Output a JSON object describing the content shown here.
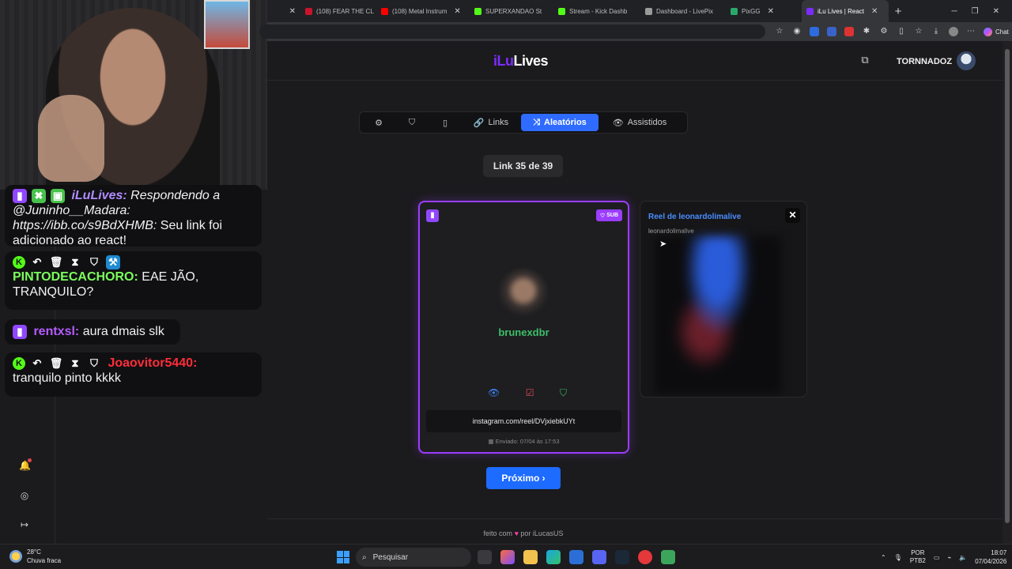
{
  "browser": {
    "tabs": [
      {
        "title": "",
        "color": "#c8142c"
      },
      {
        "title": "(108) FEAR THE CL",
        "color": "#c8142c"
      },
      {
        "title": "(108) Metal Instrum",
        "color": "#ff0000"
      },
      {
        "title": "SUPERXANDAO St",
        "color": "#53fc18"
      },
      {
        "title": "Stream - Kick Dashb",
        "color": "#53fc18"
      },
      {
        "title": "Dashboard - LivePix",
        "color": "#9a9a9a"
      },
      {
        "title": "PixGG",
        "color": "#2aa86b"
      },
      {
        "title": "iLu Lives | React",
        "color": "#7c2cff",
        "active": true
      }
    ],
    "chat_label": "Chat"
  },
  "stream_chat": {
    "messages": [
      {
        "user": "iLuLives:",
        "text_italic": "Respondendo a @Juninho__Madara: https://ibb.co/s9BdXHMB:",
        "text": "Seu link foi adicionado ao react!"
      },
      {
        "user": "PINTODECACHORO:",
        "text": "EAE JÃO, TRANQUILO?"
      },
      {
        "user": "rentxsl:",
        "text": "aura dmais slk"
      },
      {
        "user": "Joaovitor5440:",
        "text": "tranquilo pinto kkkk"
      }
    ]
  },
  "app": {
    "logo_part1": "iLu",
    "logo_part2": "Lives",
    "username": "TORNNADOZ",
    "nav": {
      "links": "Links",
      "aleatorios": "Aleatórios",
      "assistidos": "Assistidos",
      "active": "Aleatórios"
    },
    "counter": "Link 35 de 39",
    "card": {
      "sub_badge": "SUB",
      "name": "brunexdbr",
      "link": "instagram.com/reel/DVjxiebkUYt",
      "sent": "Enviado: 07/04 às 17:53"
    },
    "preview": {
      "title": "Reel de leonardolimalive",
      "subtitle": "leonardolimalive",
      "close": "✕"
    },
    "next_button": "Próximo ›",
    "footer": {
      "prefix": "feito com",
      "suffix": "por iLucasUS"
    },
    "colors": {
      "accent": "#2f6bff",
      "brand": "#7c2cff",
      "name_green": "#3dbf6a",
      "card_border": "#9b3dff"
    }
  },
  "taskbar": {
    "temp": "28°C",
    "weather": "Chuva fraca",
    "search_placeholder": "Pesquisar",
    "lang1": "POR",
    "lang2": "PTB2",
    "time": "18:07",
    "date": "07/04/2026"
  }
}
